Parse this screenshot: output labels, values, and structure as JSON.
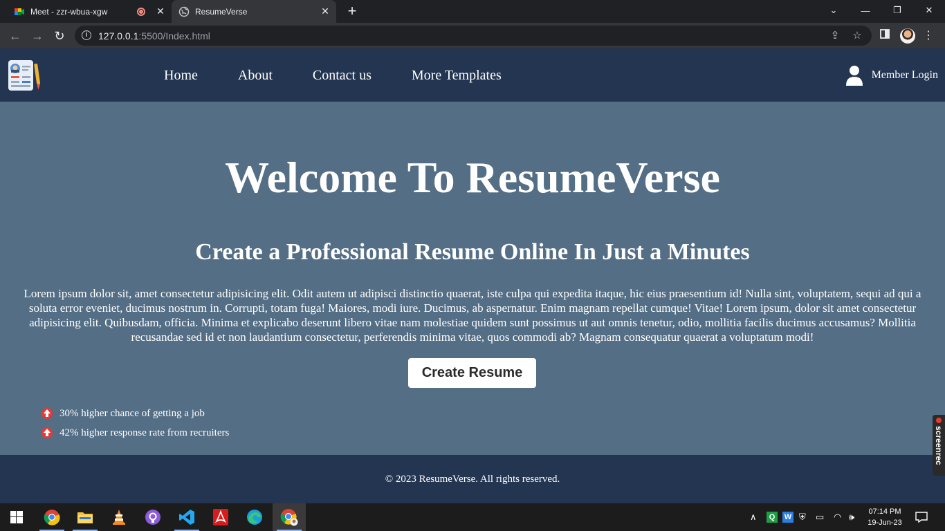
{
  "browser": {
    "tabs": [
      {
        "title": "Meet - zzr-wbua-xgw",
        "favicon": "google-meet-icon",
        "recording": true
      },
      {
        "title": "ResumeVerse",
        "favicon": "globe-icon",
        "active": true
      }
    ],
    "address": {
      "host": "127.0.0.1",
      "rest": ":5500/Index.html"
    }
  },
  "site": {
    "nav": {
      "links": [
        "Home",
        "About",
        "Contact us",
        "More Templates"
      ],
      "login_label": "Member Login"
    },
    "hero": {
      "title": "Welcome To ResumeVerse",
      "subtitle": "Create a Professional Resume Online In Just a Minutes",
      "body": "Lorem ipsum dolor sit, amet consectetur adipisicing elit. Odit autem ut adipisci distinctio quaerat, iste culpa qui expedita itaque, hic eius praesentium id! Nulla sint, voluptatem, sequi ad qui a soluta error eveniet, ducimus nostrum in. Corrupti, totam fuga! Maiores, modi iure. Ducimus, ab aspernatur. Enim magnam repellat cumque! Vitae! Lorem ipsum, dolor sit amet consectetur adipisicing elit. Quibusdam, officia. Minima et explicabo deserunt libero vitae nam molestiae quidem sunt possimus ut aut omnis tenetur, odio, mollitia facilis ducimus accusamus? Mollitia recusandae sed id et non laudantium consectetur, perferendis minima vitae, quos commodi ab? Magnam consequatur quaerat a voluptatum modi!",
      "cta": "Create Resume",
      "stats": [
        "30% higher chance of getting a job",
        "42% higher response rate from recruiters"
      ]
    },
    "footer": "© 2023 ResumeVerse. All rights reserved."
  },
  "overlay": {
    "screenrec": "screenrec"
  },
  "taskbar": {
    "apps": [
      "start-icon",
      "chrome-icon",
      "file-explorer-icon",
      "vlc-icon",
      "github-icon",
      "vscode-icon",
      "acrobat-icon",
      "edge-icon",
      "chrome-profile-icon"
    ],
    "clock": {
      "time": "07:14 PM",
      "date": "19-Jun-23"
    }
  },
  "colors": {
    "nav_bg": "#243551",
    "hero_bg": "#546e85",
    "chrome_dark": "#202124",
    "chrome_toolbar": "#35363a"
  }
}
